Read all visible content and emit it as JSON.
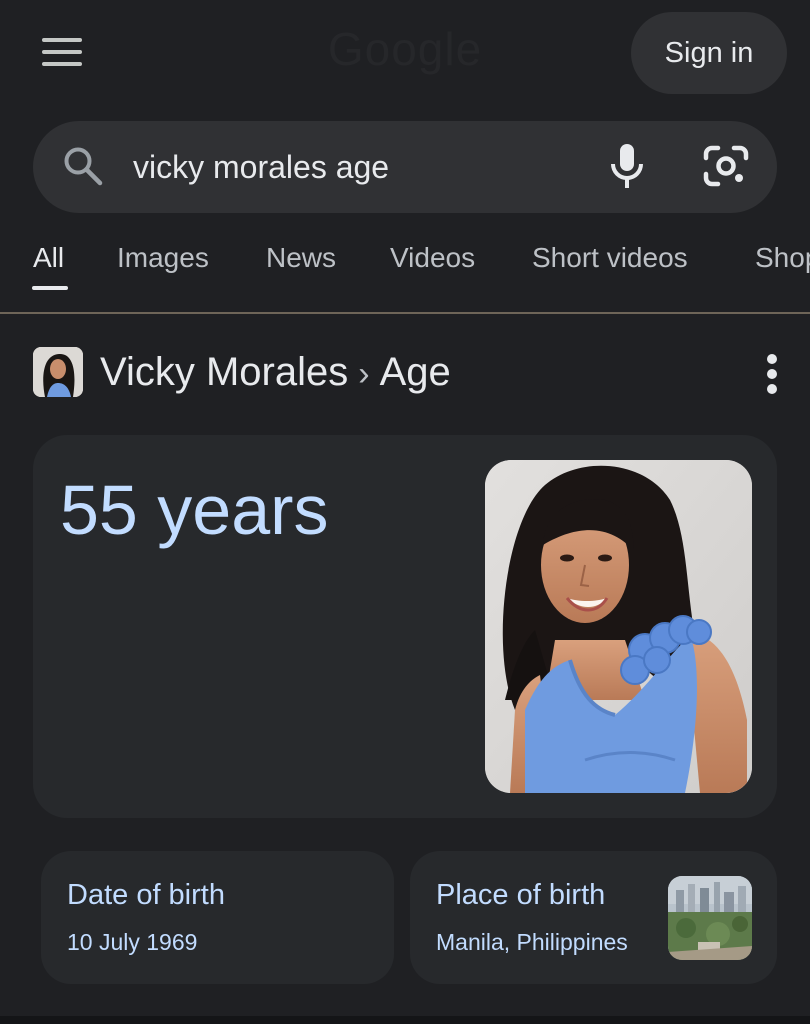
{
  "header": {
    "logo_text": "Google",
    "sign_in_label": "Sign in"
  },
  "search": {
    "query": "vicky morales age"
  },
  "tabs": [
    {
      "label": "All",
      "active": true
    },
    {
      "label": "Images"
    },
    {
      "label": "News"
    },
    {
      "label": "Videos"
    },
    {
      "label": "Short videos"
    },
    {
      "label": "Shop"
    }
  ],
  "knowledge": {
    "entity": "Vicky Morales",
    "separator": "›",
    "attribute": "Age",
    "answer": "55 years",
    "facts": [
      {
        "label": "Date of birth",
        "value": "10 July 1969"
      },
      {
        "label": "Place of birth",
        "value": "Manila, Philippines"
      }
    ]
  },
  "colors": {
    "background": "#1f2023",
    "surface": "#303134",
    "card": "#27292c",
    "answer_text": "#c2dcff",
    "dress_blue": "#6f9be0"
  }
}
